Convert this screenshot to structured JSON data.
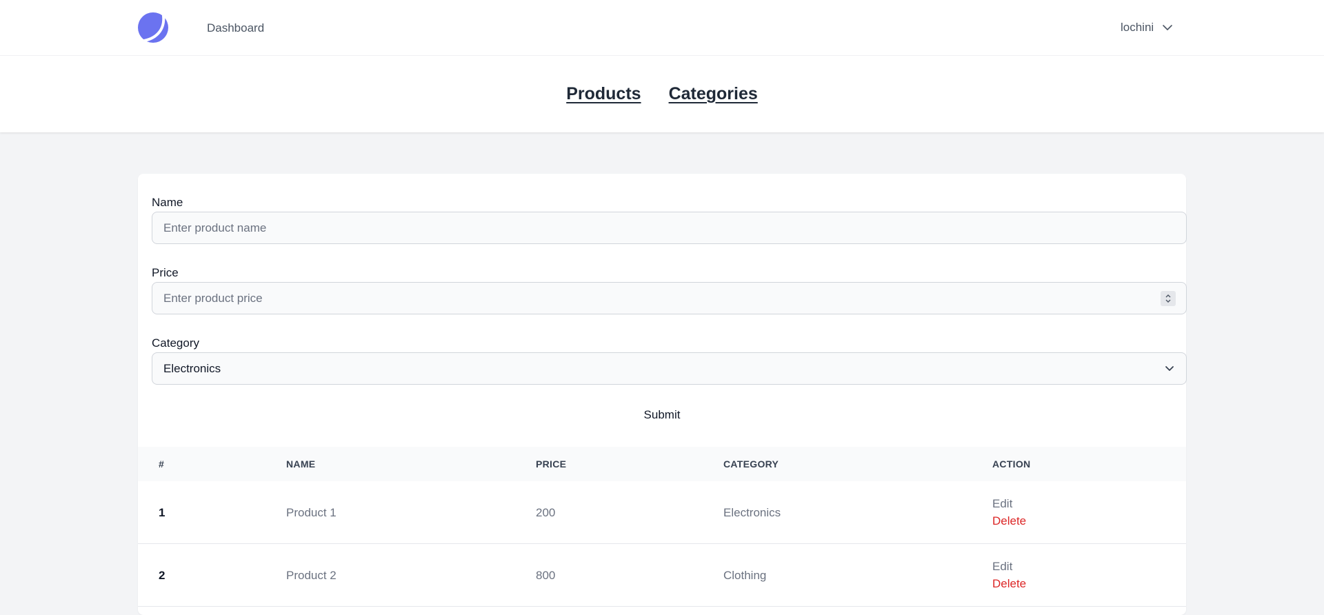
{
  "header": {
    "dashboard_link": "Dashboard",
    "user": "lochini",
    "brand_color": "#6366f1"
  },
  "subnav": {
    "products": "Products",
    "categories": "Categories"
  },
  "form": {
    "name_label": "Name",
    "name_placeholder": "Enter product name",
    "price_label": "Price",
    "price_placeholder": "Enter product price",
    "category_label": "Category",
    "category_value": "Electronics",
    "submit_label": "Submit"
  },
  "table": {
    "headers": [
      "#",
      "NAME",
      "PRICE",
      "CATEGORY",
      "ACTION"
    ],
    "rows": [
      {
        "num": "1",
        "name": "Product 1",
        "price": "200",
        "category": "Electronics",
        "edit": "Edit",
        "delete": "Delete"
      },
      {
        "num": "2",
        "name": "Product 2",
        "price": "800",
        "category": "Clothing",
        "edit": "Edit",
        "delete": "Delete"
      }
    ]
  },
  "colors": {
    "delete": "#dc2626",
    "page_bg": "#f3f4f6"
  }
}
